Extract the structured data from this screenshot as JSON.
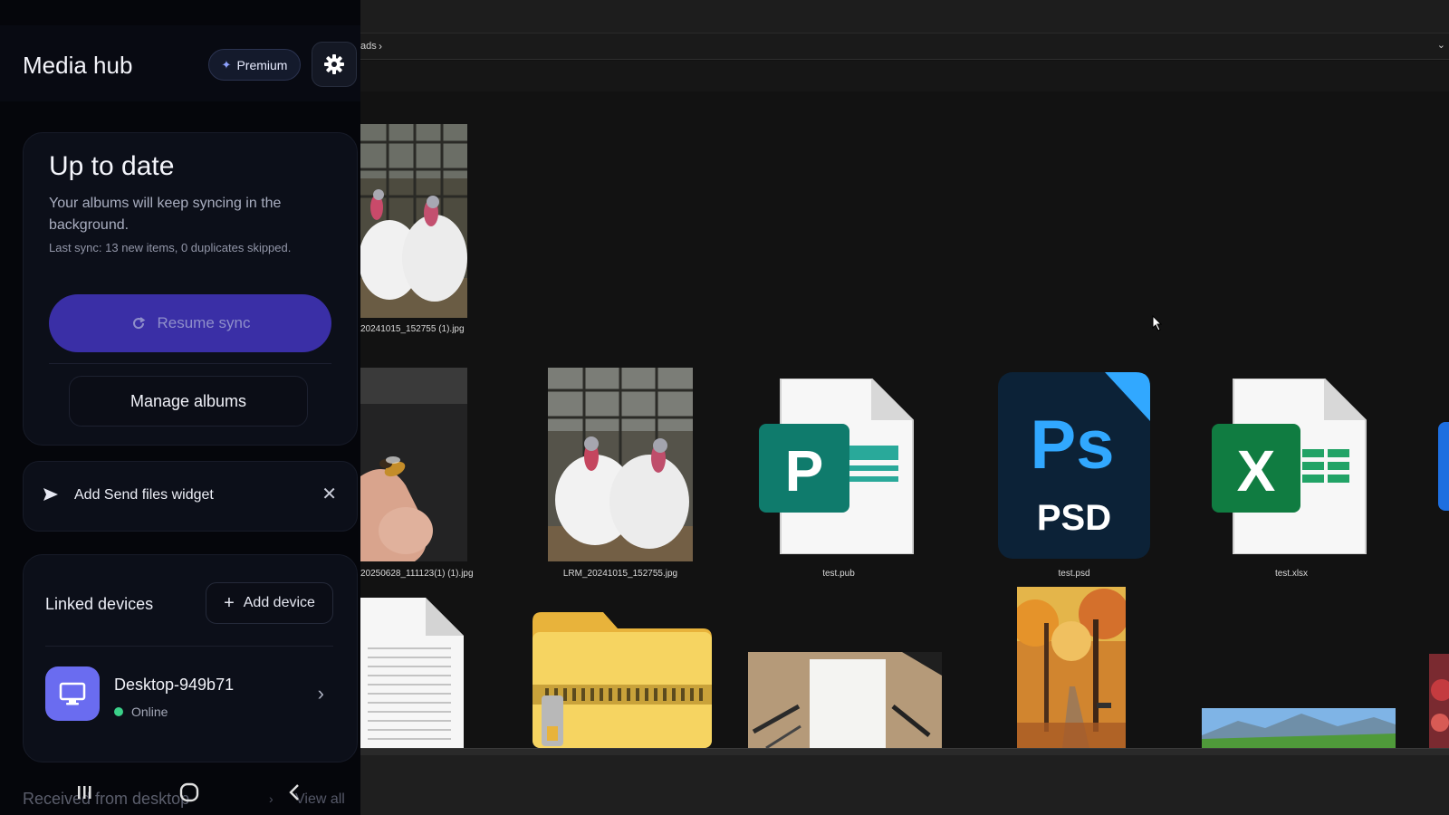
{
  "colors": {
    "accent": "#3a2fa6",
    "device_icon_bg": "#6a6cf0",
    "online_dot": "#3bd089",
    "publisher_green": "#0f7b6c",
    "photoshop_blue": "#31a8ff",
    "excel_green": "#107c41"
  },
  "app": {
    "title": "Media hub",
    "premium_label": "Premium",
    "settings_icon": "gear-icon"
  },
  "sync": {
    "title": "Up to date",
    "description": "Your albums will keep syncing in the background.",
    "meta": "Last sync: 13 new items, 0 duplicates skipped.",
    "resume_label": "Resume sync",
    "manage_label": "Manage albums"
  },
  "widget": {
    "label": "Add Send files widget"
  },
  "devices": {
    "title": "Linked devices",
    "add_label": "Add device",
    "items": [
      {
        "name": "Desktop-949b71",
        "status": "Online"
      }
    ]
  },
  "received": {
    "title": "Received from desktop",
    "view_all": "View all"
  },
  "explorer": {
    "breadcrumb": "ads",
    "files": [
      {
        "name": "20241015_152755 (1).jpg",
        "kind": "photo-turkeys"
      },
      {
        "name": "20250628_111123(1) (1).jpg",
        "kind": "photo-bee"
      },
      {
        "name": "LRM_20241015_152755.jpg",
        "kind": "photo-turkeys"
      },
      {
        "name": "test.pub",
        "kind": "publisher"
      },
      {
        "name": "test.psd",
        "kind": "photoshop"
      },
      {
        "name": "test.xlsx",
        "kind": "excel"
      }
    ],
    "icons": {
      "publisher_letter": "P",
      "photoshop_letters": "Ps",
      "photoshop_caption": "PSD",
      "excel_letter": "X"
    }
  }
}
